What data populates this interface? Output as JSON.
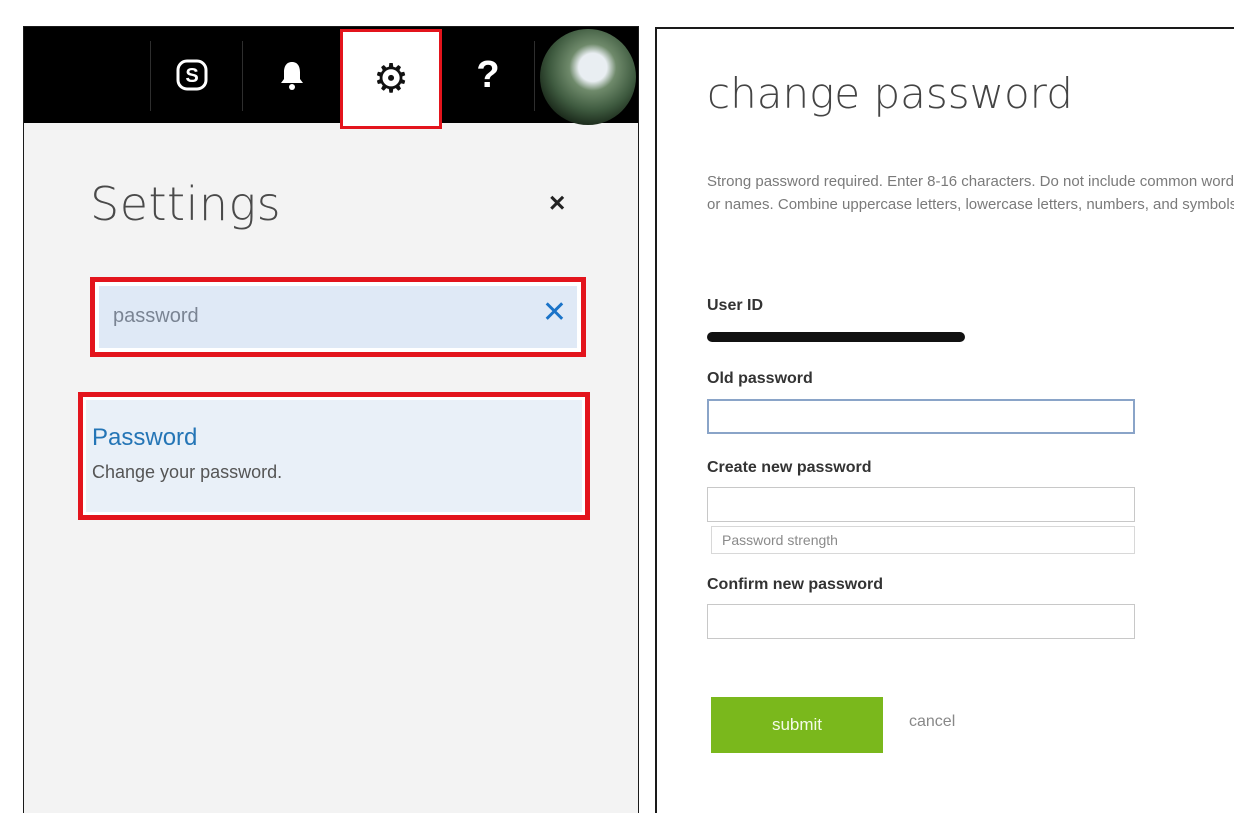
{
  "topbar": {
    "skype_icon": "skype-icon",
    "notification_icon": "bell-icon",
    "settings_icon": "gear-icon",
    "help_icon": "question-icon",
    "gear_glyph": "⚙",
    "help_glyph": "?"
  },
  "settings_panel": {
    "title": "Settings",
    "close_glyph": "×",
    "search": {
      "value": "password",
      "clear_glyph": "✕"
    },
    "result": {
      "title": "Password",
      "description": "Change your password."
    }
  },
  "change_password": {
    "title": "change password",
    "description": "Strong password required. Enter 8-16 characters. Do not include common words or names. Combine uppercase letters, lowercase letters, numbers, and symbols.",
    "user_id_label": "User ID",
    "old_password_label": "Old password",
    "new_password_label": "Create new password",
    "password_strength_label": "Password strength",
    "confirm_password_label": "Confirm new password",
    "submit_label": "submit",
    "cancel_label": "cancel"
  },
  "colors": {
    "highlight": "#e3141c",
    "link": "#2475b6",
    "submit": "#7ab81c",
    "topbar": "#000000"
  }
}
